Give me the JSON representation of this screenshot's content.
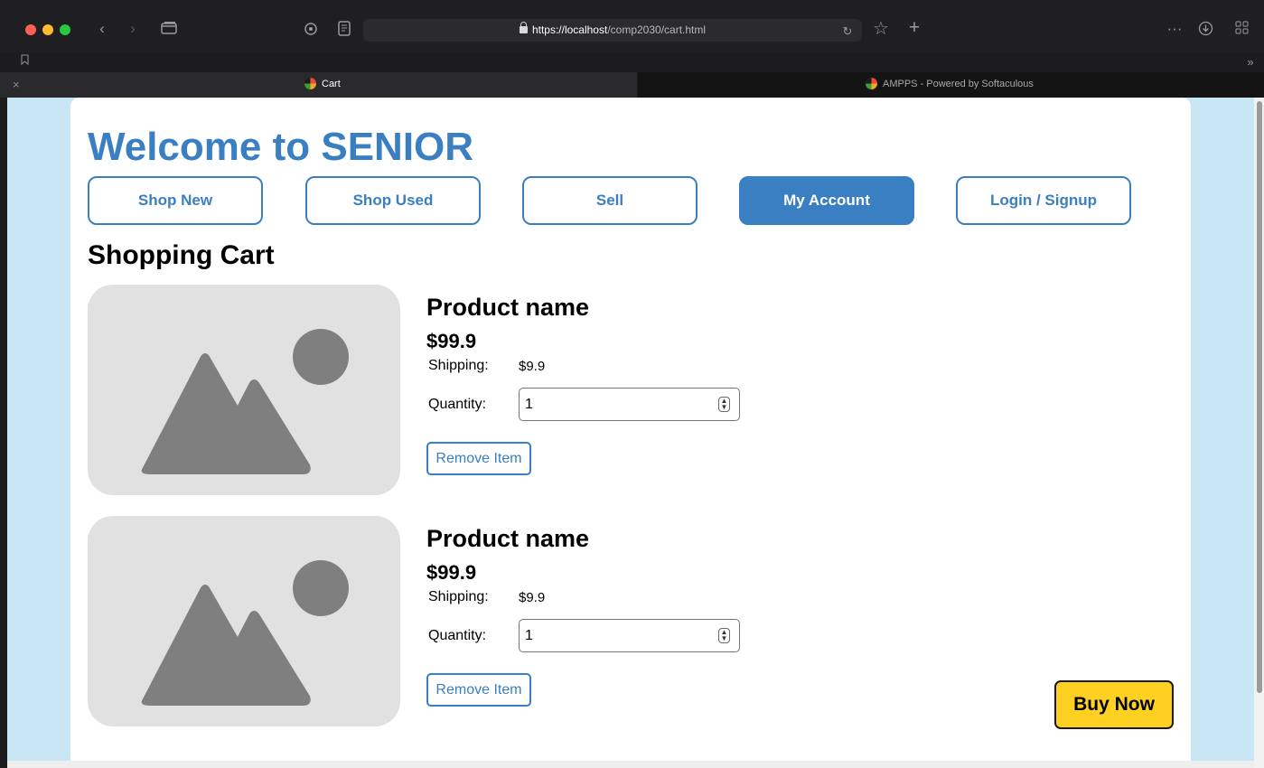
{
  "browser": {
    "url_host": "https://localhost",
    "url_path": "/comp2030/cart.html",
    "tabs": [
      {
        "title": "Cart",
        "active": true
      },
      {
        "title": "AMPPS - Powered by Softaculous",
        "active": false
      }
    ],
    "icons": [
      "back-icon",
      "forward-icon",
      "tab-overview-icon",
      "extensions-icon",
      "reader-icon",
      "lock-icon",
      "reload-icon",
      "star-icon",
      "new-tab-icon",
      "more-icon",
      "download-icon",
      "grid-icon",
      "bookmark-icon",
      "chevron-right-icon",
      "close-icon"
    ]
  },
  "site": {
    "title": "Welcome to SENIOR",
    "nav": [
      {
        "label": "Shop New",
        "active": false
      },
      {
        "label": "Shop Used",
        "active": false
      },
      {
        "label": "Sell",
        "active": false
      },
      {
        "label": "My Account",
        "active": true
      },
      {
        "label": "Login / Signup",
        "active": false
      }
    ]
  },
  "cart": {
    "heading": "Shopping Cart",
    "items": [
      {
        "name": "Product name",
        "price": "$99.9",
        "shipping_label": "Shipping:",
        "shipping": "$9.9",
        "quantity_label": "Quantity:",
        "quantity": "1",
        "remove_label": "Remove Item"
      },
      {
        "name": "Product name",
        "price": "$99.9",
        "shipping_label": "Shipping:",
        "shipping": "$9.9",
        "quantity_label": "Quantity:",
        "quantity": "1",
        "remove_label": "Remove Item"
      }
    ],
    "buy_label": "Buy Now"
  },
  "colors": {
    "brand_blue": "#3a7fc1",
    "page_bg": "#c8e6f4",
    "buy_yellow": "#fdd022"
  }
}
